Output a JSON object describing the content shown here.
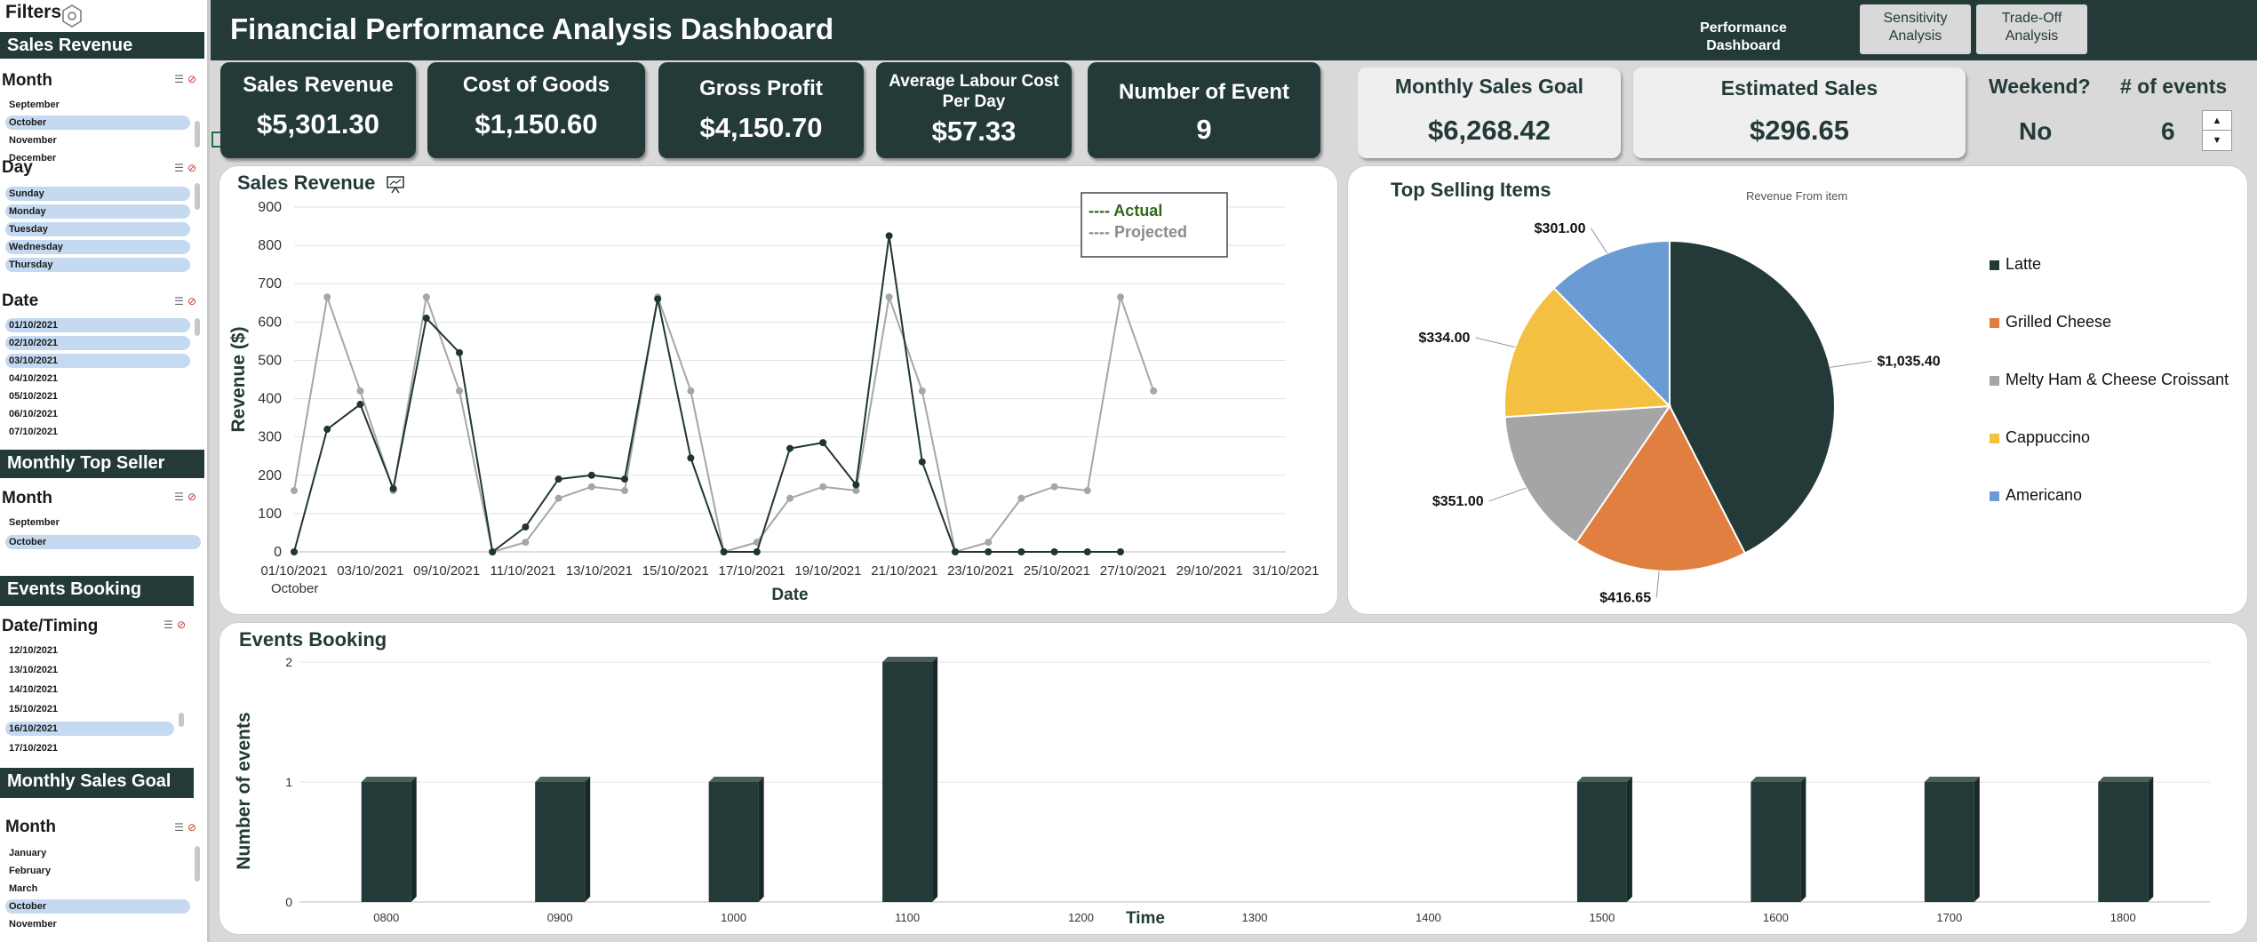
{
  "sidebar": {
    "filters_label": "Filters",
    "sales_revenue_header": "Sales Revenue",
    "month_slicer": {
      "title": "Month",
      "items": [
        {
          "label": "September",
          "selected": false
        },
        {
          "label": "October",
          "selected": true
        },
        {
          "label": "November",
          "selected": false
        },
        {
          "label": "December",
          "selected": false
        }
      ]
    },
    "day_slicer": {
      "title": "Day",
      "items": [
        {
          "label": "Sunday",
          "selected": true
        },
        {
          "label": "Monday",
          "selected": true
        },
        {
          "label": "Tuesday",
          "selected": true
        },
        {
          "label": "Wednesday",
          "selected": true
        },
        {
          "label": "Thursday",
          "selected": true
        }
      ]
    },
    "date_slicer": {
      "title": "Date",
      "items": [
        {
          "label": "01/10/2021",
          "selected": true
        },
        {
          "label": "02/10/2021",
          "selected": true
        },
        {
          "label": "03/10/2021",
          "selected": true
        },
        {
          "label": "04/10/2021",
          "selected": false
        },
        {
          "label": "05/10/2021",
          "selected": false
        },
        {
          "label": "06/10/2021",
          "selected": false
        },
        {
          "label": "07/10/2021",
          "selected": false
        }
      ]
    },
    "monthly_top_seller_header": "Monthly Top Seller",
    "mts_month_slicer": {
      "title": "Month",
      "items": [
        {
          "label": "September",
          "selected": false
        },
        {
          "label": "October",
          "selected": true
        }
      ]
    },
    "events_booking_header": "Events Booking",
    "datetiming_slicer": {
      "title": "Date/Timing",
      "items": [
        {
          "label": "12/10/2021",
          "selected": false
        },
        {
          "label": "13/10/2021",
          "selected": false
        },
        {
          "label": "14/10/2021",
          "selected": false
        },
        {
          "label": "15/10/2021",
          "selected": false
        },
        {
          "label": "16/10/2021",
          "selected": true
        },
        {
          "label": "17/10/2021",
          "selected": false
        }
      ]
    },
    "monthly_sales_goal_header": "Monthly Sales Goal",
    "msg_month_slicer": {
      "title": "Month",
      "items": [
        {
          "label": "January",
          "selected": false
        },
        {
          "label": "February",
          "selected": false
        },
        {
          "label": "March",
          "selected": false
        },
        {
          "label": "October",
          "selected": true
        },
        {
          "label": "November",
          "selected": false
        }
      ]
    }
  },
  "header": {
    "title": "Financial Performance Analysis Dashboard",
    "nav_performance": "Performance Dashboard",
    "nav_sensitivity": "Sensitivity Analysis",
    "nav_tradeoff": "Trade-Off Analysis"
  },
  "kpis": {
    "sales_revenue": {
      "label": "Sales Revenue",
      "value": "$5,301.30"
    },
    "cost_of_goods": {
      "label": "Cost of Goods",
      "value": "$1,150.60"
    },
    "gross_profit": {
      "label": "Gross Profit",
      "value": "$4,150.70"
    },
    "avg_labour": {
      "label": "Average Labour Cost Per Day",
      "value": "$57.33"
    },
    "num_events": {
      "label": "Number of Event",
      "value": "9"
    },
    "monthly_goal": {
      "label": "Monthly Sales Goal",
      "value": "$6,268.42"
    },
    "estimated_sales": {
      "label": "Estimated Sales",
      "value": "$296.65"
    },
    "weekend": {
      "label": "Weekend?",
      "value": "No"
    },
    "events_count": {
      "label": "# of events",
      "value": "6"
    }
  },
  "charts": {
    "sales_revenue_title": "Sales Revenue",
    "top_selling_title": "Top Selling Items",
    "top_selling_subtitle": "Revenue From item",
    "events_booking_title": "Events Booking"
  },
  "colors": {
    "dark": "#243a38",
    "actual": "#1f3532",
    "projected": "#a6a6a6",
    "orange": "#e07f3f",
    "grey": "#a5a5a5",
    "yellow": "#f4c042",
    "blue": "#6a9bd2"
  },
  "chart_data": [
    {
      "type": "line",
      "title": "Sales Revenue",
      "xlabel": "Date",
      "ylabel": "Revenue ($)",
      "ylim": [
        0,
        900
      ],
      "yticks": [
        0,
        100,
        200,
        300,
        400,
        500,
        600,
        700,
        800,
        900
      ],
      "x": [
        "01/10/2021",
        "02/10/2021",
        "03/10/2021",
        "04/10/2021",
        "05/10/2021",
        "06/10/2021",
        "07/10/2021",
        "08/10/2021",
        "09/10/2021",
        "10/10/2021",
        "11/10/2021",
        "12/10/2021",
        "13/10/2021",
        "14/10/2021",
        "15/10/2021",
        "16/10/2021",
        "17/10/2021",
        "18/10/2021",
        "19/10/2021",
        "20/10/2021",
        "21/10/2021",
        "22/10/2021",
        "23/10/2021",
        "24/10/2021",
        "25/10/2021",
        "26/10/2021",
        "27/10/2021",
        "28/10/2021",
        "29/10/2021",
        "30/10/2021",
        "31/10/2021"
      ],
      "xtick_labels": [
        "01/10/2021",
        "03/10/2021",
        "09/10/2021",
        "11/10/2021",
        "13/10/2021",
        "15/10/2021",
        "17/10/2021",
        "19/10/2021",
        "21/10/2021",
        "23/10/2021",
        "25/10/2021",
        "27/10/2021",
        "29/10/2021",
        "31/10/2021"
      ],
      "xaxis_group_label": "October",
      "series": [
        {
          "name": "Actual",
          "values": [
            0,
            320,
            385,
            165,
            610,
            520,
            0,
            65,
            190,
            200,
            190,
            660,
            245,
            0,
            0,
            270,
            285,
            175,
            825,
            235,
            0,
            0,
            0,
            0,
            0,
            0
          ]
        },
        {
          "name": "Projected",
          "values": [
            160,
            665,
            420,
            160,
            665,
            420,
            0,
            25,
            140,
            170,
            160,
            665,
            420,
            0,
            25,
            140,
            170,
            160,
            665,
            420,
            0,
            25,
            140,
            170,
            160,
            665,
            420
          ]
        }
      ],
      "legend": {
        "position": "top-right",
        "entries": [
          "---- Actual",
          "---- Projected"
        ]
      }
    },
    {
      "type": "pie",
      "title": "Top Selling Items",
      "subtitle": "Revenue From item",
      "slices": [
        {
          "label": "Latte",
          "value": 1035.4,
          "display": "$1,035.40",
          "color": "#243a38"
        },
        {
          "label": "Grilled Cheese",
          "value": 416.65,
          "display": "$416.65",
          "color": "#e07f3f"
        },
        {
          "label": "Melty Ham & Cheese Croissant",
          "value": 351.0,
          "display": "$351.00",
          "color": "#a5a5a5"
        },
        {
          "label": "Cappuccino",
          "value": 334.0,
          "display": "$334.00",
          "color": "#f4c042"
        },
        {
          "label": "Americano",
          "value": 301.0,
          "display": "$301.00",
          "color": "#6a9bd2"
        }
      ],
      "legend": {
        "position": "right"
      }
    },
    {
      "type": "bar",
      "title": "Events Booking",
      "xlabel": "Time",
      "ylabel": "Number of events",
      "ylim": [
        0,
        2
      ],
      "yticks": [
        0,
        1,
        2
      ],
      "categories": [
        "0800",
        "0900",
        "1000",
        "1100",
        "1200",
        "1300",
        "1400",
        "1500",
        "1600",
        "1700",
        "1800"
      ],
      "values": [
        1,
        1,
        1,
        2,
        0,
        0,
        0,
        1,
        1,
        1,
        1
      ]
    }
  ]
}
